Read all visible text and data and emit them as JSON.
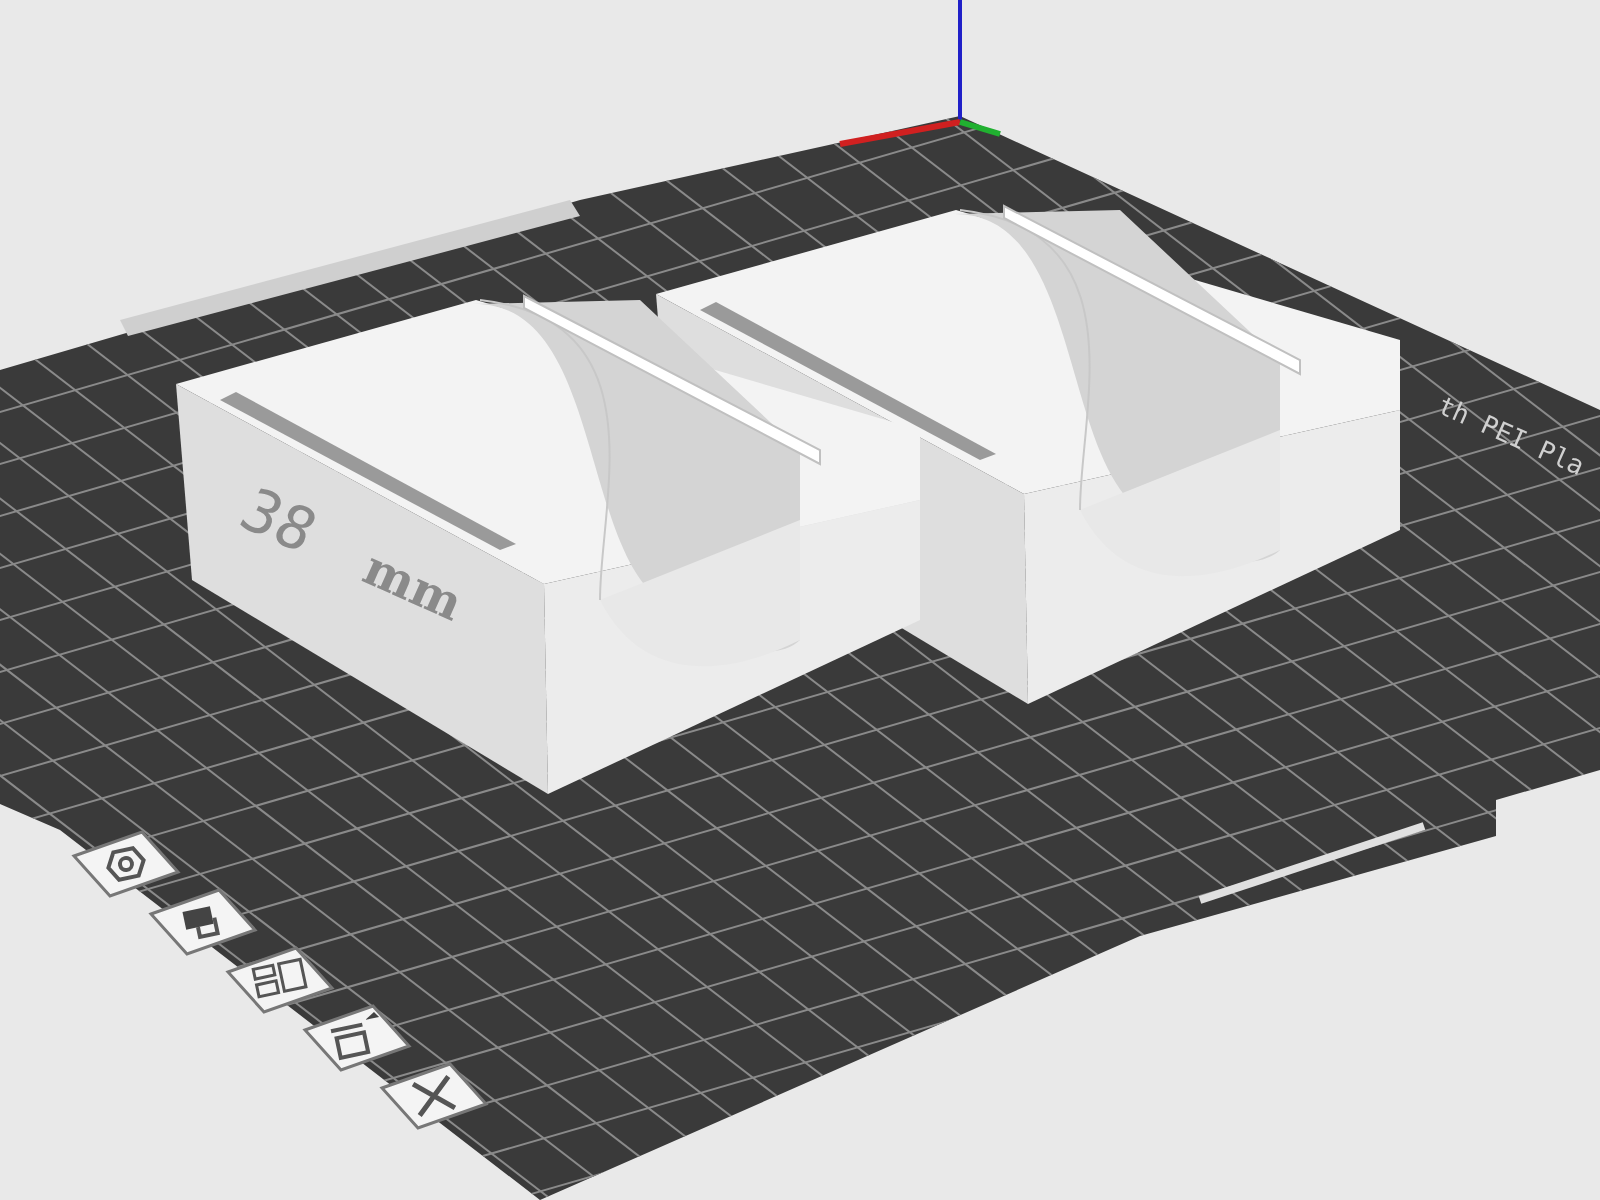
{
  "model_label": {
    "number": "38",
    "unit": "mm"
  },
  "bed_label": "th PEI Pla",
  "toolbar": [
    {
      "kind": "hexagon"
    },
    {
      "kind": "cup"
    },
    {
      "kind": "layout"
    },
    {
      "kind": "window"
    },
    {
      "kind": "cross"
    }
  ]
}
